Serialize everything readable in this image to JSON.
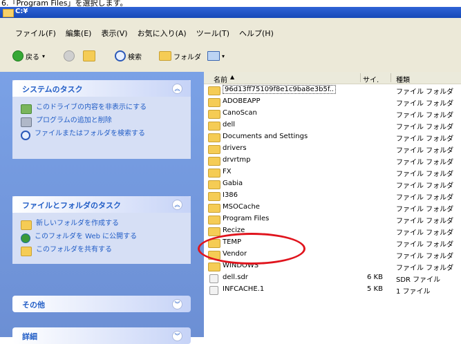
{
  "instruction": "6.「Program Files」を選択します。",
  "window": {
    "title": "C:¥"
  },
  "menu": [
    "ファイル(F)",
    "編集(E)",
    "表示(V)",
    "お気に入り(A)",
    "ツール(T)",
    "ヘルプ(H)"
  ],
  "toolbar": {
    "back": "戻る",
    "search": "検索",
    "folders": "フォルダ"
  },
  "panels": {
    "system": {
      "title": "システムのタスク",
      "items": [
        "このドライブの内容を非表示にする",
        "プログラムの追加と削除",
        "ファイルまたはフォルダを検索する"
      ]
    },
    "file": {
      "title": "ファイルとフォルダのタスク",
      "items": [
        "新しいフォルダを作成する",
        "このフォルダを Web に公開する",
        "このフォルダを共有する"
      ]
    },
    "other": {
      "title": "その他"
    },
    "details": {
      "title": "詳細"
    }
  },
  "columns": {
    "name": "名前",
    "size": "サイ.",
    "type": "種類"
  },
  "files": [
    {
      "name": "96d13ff75109f8e1c9ba8e3b5f..",
      "size": "",
      "type": "ファイル フォルダ",
      "kind": "folder"
    },
    {
      "name": "ADOBEAPP",
      "size": "",
      "type": "ファイル フォルダ",
      "kind": "folder"
    },
    {
      "name": "CanoScan",
      "size": "",
      "type": "ファイル フォルダ",
      "kind": "folder"
    },
    {
      "name": "dell",
      "size": "",
      "type": "ファイル フォルダ",
      "kind": "folder"
    },
    {
      "name": "Documents and Settings",
      "size": "",
      "type": "ファイル フォルダ",
      "kind": "folder"
    },
    {
      "name": "drivers",
      "size": "",
      "type": "ファイル フォルダ",
      "kind": "folder"
    },
    {
      "name": "drvrtmp",
      "size": "",
      "type": "ファイル フォルダ",
      "kind": "folder"
    },
    {
      "name": "FX",
      "size": "",
      "type": "ファイル フォルダ",
      "kind": "folder"
    },
    {
      "name": "Gabia",
      "size": "",
      "type": "ファイル フォルダ",
      "kind": "folder"
    },
    {
      "name": "I386",
      "size": "",
      "type": "ファイル フォルダ",
      "kind": "folder"
    },
    {
      "name": "MSOCache",
      "size": "",
      "type": "ファイル フォルダ",
      "kind": "folder"
    },
    {
      "name": "Program Files",
      "size": "",
      "type": "ファイル フォルダ",
      "kind": "folder"
    },
    {
      "name": "Recize",
      "size": "",
      "type": "ファイル フォルダ",
      "kind": "folder"
    },
    {
      "name": "TEMP",
      "size": "",
      "type": "ファイル フォルダ",
      "kind": "folder"
    },
    {
      "name": "Vendor",
      "size": "",
      "type": "ファイル フォルダ",
      "kind": "folder"
    },
    {
      "name": "WINDOWS",
      "size": "",
      "type": "ファイル フォルダ",
      "kind": "folder"
    },
    {
      "name": "dell.sdr",
      "size": "6 KB",
      "type": "SDR ファイル",
      "kind": "file"
    },
    {
      "name": "INFCACHE.1",
      "size": "5 KB",
      "type": "1 ファイル",
      "kind": "file"
    }
  ]
}
